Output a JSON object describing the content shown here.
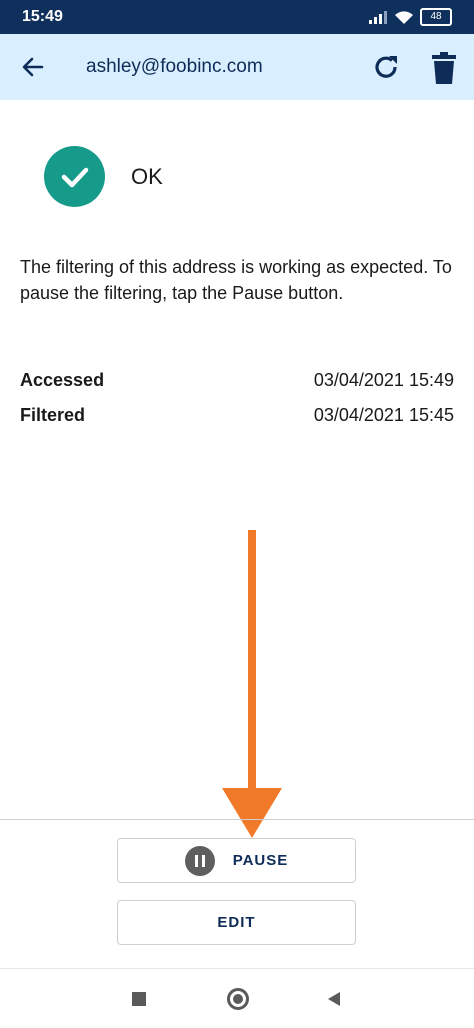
{
  "status_bar": {
    "time": "15:49",
    "battery": "48",
    "icons": [
      "signal-icon",
      "wifi-icon",
      "battery-icon"
    ]
  },
  "app_bar": {
    "title": "ashley@foobinc.com",
    "back_icon": "arrow-left-icon",
    "refresh_icon": "refresh-icon",
    "delete_icon": "trash-icon"
  },
  "status": {
    "label": "OK",
    "icon": "check-circle-icon",
    "color": "#169b8b"
  },
  "description": "The filtering of this address is working as expected. To pause the filtering, tap the Pause button.",
  "info": [
    {
      "label": "Accessed",
      "value": "03/04/2021 15:49"
    },
    {
      "label": "Filtered",
      "value": "03/04/2021 15:45"
    }
  ],
  "annotation": {
    "arrow_color": "#f07a2a"
  },
  "buttons": {
    "pause_label": "PAUSE",
    "edit_label": "EDIT"
  },
  "nav": [
    "recents-icon",
    "home-icon",
    "back-icon"
  ]
}
